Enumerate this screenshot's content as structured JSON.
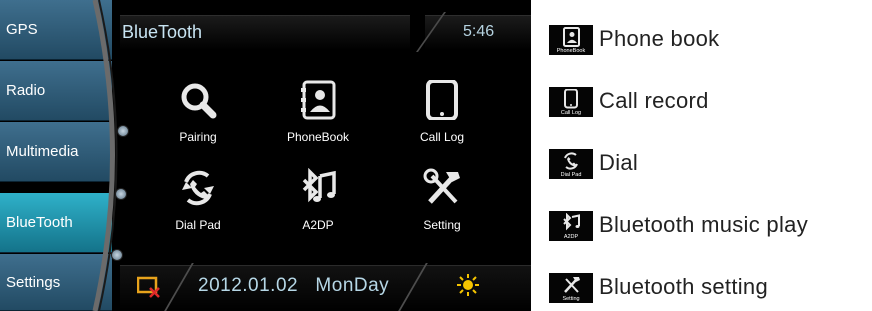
{
  "sidebar": {
    "items": [
      {
        "label": "GPS"
      },
      {
        "label": "Radio"
      },
      {
        "label": "Multimedia"
      },
      {
        "label": "BlueTooth",
        "active": true
      },
      {
        "label": "Settings"
      }
    ]
  },
  "header": {
    "title": "BlueTooth",
    "time": "5:46"
  },
  "apps": [
    {
      "label": "Pairing",
      "icon": "magnifier-icon"
    },
    {
      "label": "PhoneBook",
      "icon": "phonebook-icon"
    },
    {
      "label": "Call Log",
      "icon": "call-log-icon"
    },
    {
      "label": "Dial Pad",
      "icon": "dial-pad-icon"
    },
    {
      "label": "A2DP",
      "icon": "bluetooth-music-icon"
    },
    {
      "label": "Setting",
      "icon": "tools-icon"
    }
  ],
  "status": {
    "date": "2012.01.02   MonDay"
  },
  "legend": [
    {
      "caption": "PhoneBook",
      "text": "Phone book"
    },
    {
      "caption": "Call Log",
      "text": "Call record"
    },
    {
      "caption": "Dial Pad",
      "text": "Dial"
    },
    {
      "caption": "A2DP",
      "text": "Bluetooth music play"
    },
    {
      "caption": "Setting",
      "text": "Bluetooth setting"
    }
  ],
  "colors": {
    "nav_item": "#2f5c78",
    "nav_active": "#1fa2bd",
    "accent_text": "#c8e4f2",
    "brightness_icon": "#f5c400",
    "no_signal_icon": "#e8a31c"
  }
}
